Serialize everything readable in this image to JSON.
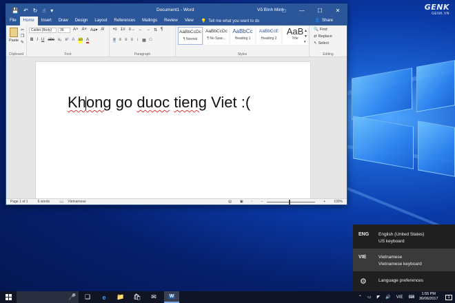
{
  "brand": {
    "name": "GENK",
    "site": "GENK.VN"
  },
  "word": {
    "quick_access": {
      "save_icon": "save-icon",
      "undo_icon": "undo-icon",
      "redo_icon": "redo-icon",
      "touch_icon": "touch-mode-icon"
    },
    "doc_title": "Document1 - Word",
    "user_name": "Võ Bình Minh",
    "tabs": [
      "File",
      "Home",
      "Insert",
      "Draw",
      "Design",
      "Layout",
      "References",
      "Mailings",
      "Review",
      "View"
    ],
    "active_tab": "Home",
    "tell_me": "Tell me what you want to do",
    "share": "Share",
    "ribbon": {
      "clipboard": {
        "label": "Clipboard",
        "paste": "Paste"
      },
      "font": {
        "label": "Font",
        "font_name": "Calibri (Body)",
        "font_size": "36",
        "row1": [
          "A˄",
          "A˅",
          "Aa▾",
          "A̸"
        ],
        "row2": [
          "B",
          "I",
          "U",
          "abc",
          "x₂",
          "x²",
          "A",
          "ab",
          "A"
        ]
      },
      "paragraph": {
        "label": "Paragraph",
        "row1": [
          "•≡",
          "1≡",
          "≡→",
          "←",
          "→",
          "⇅",
          "¶"
        ],
        "row2": [
          "≡",
          "≡",
          "≡",
          "≡",
          "↕",
          "▦",
          "□"
        ]
      },
      "styles": {
        "label": "Styles",
        "items": [
          {
            "sample": "AaBbCcDc",
            "name": "¶ Normal"
          },
          {
            "sample": "AaBbCcDc",
            "name": "¶ No Spac..."
          },
          {
            "sample": "AaBbCc",
            "name": "Heading 1"
          },
          {
            "sample": "AaBbCcE",
            "name": "Heading 2"
          },
          {
            "sample": "AaB",
            "name": "Title"
          }
        ]
      },
      "editing": {
        "label": "Editing",
        "find": "Find",
        "replace": "Replace",
        "select": "Select"
      }
    },
    "document": {
      "words": [
        "Khong",
        "go",
        "duoc",
        "tieng",
        "Viet",
        ":("
      ],
      "caret_after": "Kh"
    },
    "status": {
      "page": "Page 1 of 1",
      "words": "6 words",
      "language": "Vietnamese",
      "zoom": "100%"
    }
  },
  "language_flyout": {
    "items": [
      {
        "code": "ENG",
        "name": "English (United States)",
        "keyboard": "US keyboard",
        "selected": false
      },
      {
        "code": "VIE",
        "name": "Vietnamese",
        "keyboard": "Vietnamese keyboard",
        "selected": true
      }
    ],
    "preferences": "Language preferences"
  },
  "taskbar": {
    "tray_lang": "VIE",
    "time": "1:55 PM",
    "date": "30/06/2017",
    "notifications": "1"
  }
}
